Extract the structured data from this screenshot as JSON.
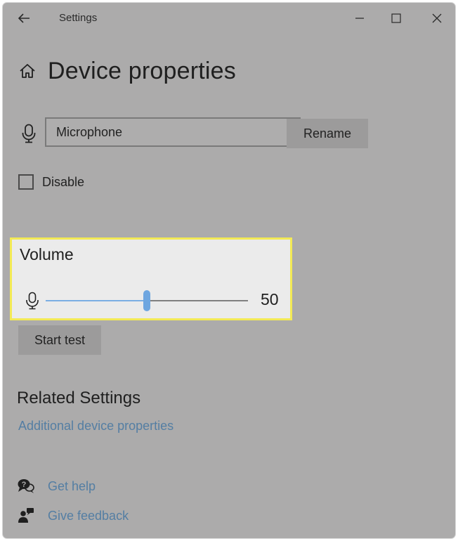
{
  "window": {
    "title": "Settings",
    "back_icon": "back-arrow-icon",
    "controls": [
      "minimize-icon",
      "maximize-icon",
      "close-icon"
    ]
  },
  "page": {
    "title": "Device properties",
    "icon": "home-icon"
  },
  "device": {
    "icon": "microphone-icon",
    "name_value": "Microphone",
    "rename_label": "Rename"
  },
  "disable": {
    "label": "Disable",
    "checked": false
  },
  "volume": {
    "label": "Volume",
    "icon": "microphone-icon",
    "value": "50",
    "level_percent": 50,
    "highlight_color": "#f3ea55",
    "accent_color": "#6ea6e0"
  },
  "start_test_label": "Start test",
  "related": {
    "title": "Related Settings",
    "link": "Additional device properties"
  },
  "help": {
    "get_help": "Get help",
    "give_feedback": "Give feedback"
  }
}
